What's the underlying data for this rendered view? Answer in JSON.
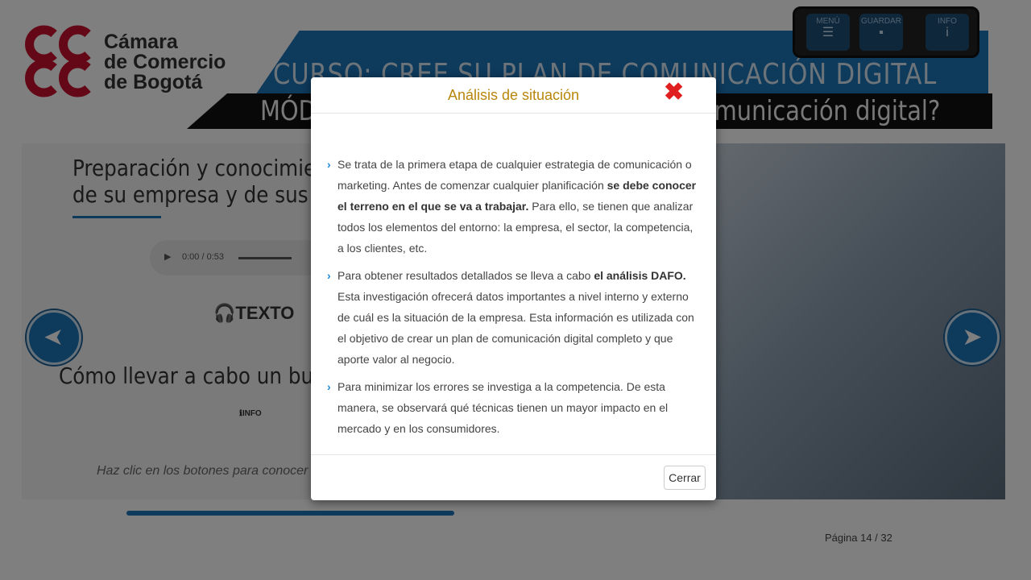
{
  "brand": {
    "logo_lines": [
      "Cámara",
      "de Comercio",
      "de Bogotá"
    ],
    "accent_color": "#1d74b8"
  },
  "course": {
    "title": "CURSO: CREE SU PLAN DE COMUNICACIÓN DIGITAL",
    "module": "MÓDULO 1: ¿Cómo crear un plan de comunicación digital?"
  },
  "topnav": {
    "menu_label": "MENÚ",
    "save_label": "GUARDAR",
    "info_label": "INFO"
  },
  "content": {
    "heading1_line1": "Preparación y conocimiento",
    "heading1_line2": "de su empresa y de sus clientes",
    "audio_time": "0:00 / 0:53",
    "texto_label": "TEXTO",
    "heading2": "Cómo llevar a cabo un buen análisis",
    "info_label": "INFO",
    "hint": "Haz clic en los botones para conocer más información"
  },
  "footer": {
    "page_label": "Página 14 / 32",
    "progress_percent": 44
  },
  "modal": {
    "title": "Análisis de situación",
    "close_button": "Cerrar",
    "p1_a": "Se trata de la primera etapa de cualquier estrategia de comunicación o marketing. Antes de comenzar cualquier planificación ",
    "p1_b": "se debe conocer el terreno en el que se va a trabajar.",
    "p1_c": " Para ello, se tienen que analizar todos los elementos del entorno: la empresa, el sector, la competencia, a los clientes, etc.",
    "p2_a": "Para obtener resultados detallados se lleva a cabo ",
    "p2_b": "el análisis DAFO.",
    "p2_c": " Esta investigación ofrecerá datos importantes a nivel interno y externo de cuál es la situación de la empresa. Esta información es utilizada con el objetivo de crear un plan de comunicación digital completo y que aporte valor al negocio.",
    "p3": "Para minimizar los errores se investiga a la competencia. De esta manera, se observará qué técnicas tienen un mayor impacto en el mercado y en los consumidores."
  }
}
